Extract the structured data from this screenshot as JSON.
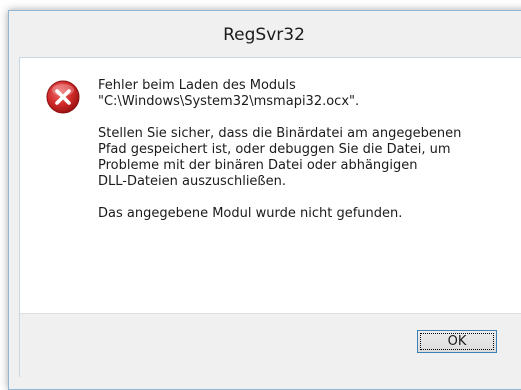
{
  "window": {
    "title": "RegSvr32"
  },
  "dialog": {
    "icon": "error-icon",
    "messages": [
      "Fehler beim Laden des Moduls\n\"C:\\Windows\\System32\\msmapi32.ocx\".",
      "Stellen Sie sicher, dass die Binärdatei am angegebenen\nPfad gespeichert ist, oder debuggen Sie die Datei, um\nProbleme mit der binären Datei oder abhängigen\nDLL-Dateien auszuschließen.",
      "Das angegebene Modul wurde nicht gefunden."
    ],
    "ok_label": "OK"
  },
  "colors": {
    "error_red": "#c1272d",
    "button_border": "#3c7fb1",
    "window_border": "#8fb6d4"
  }
}
